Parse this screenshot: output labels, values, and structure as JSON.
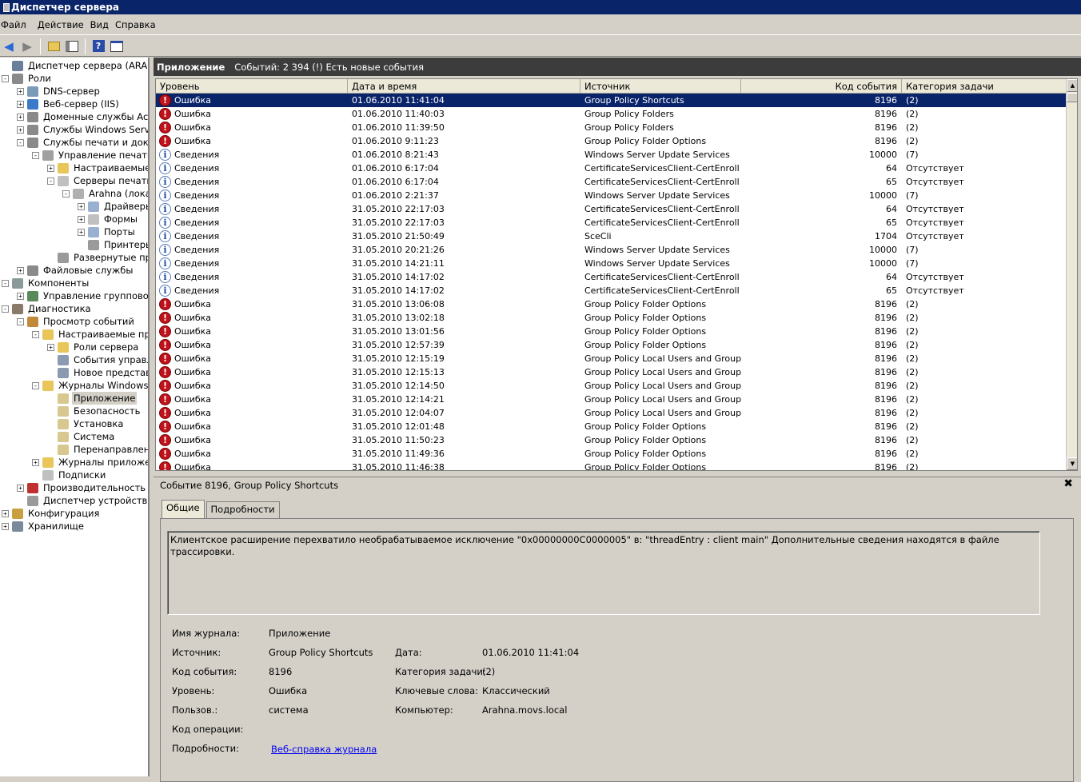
{
  "window": {
    "title": "Диспетчер сервера"
  },
  "menu": [
    "Файл",
    "Действие",
    "Вид",
    "Справка"
  ],
  "toolbar": {
    "buttons": [
      "back-icon",
      "forward-icon",
      "up-folder-icon",
      "show-hide-tree-icon",
      "help-icon",
      "properties-icon"
    ]
  },
  "tree": [
    {
      "label": "Диспетчер сервера (ARAHNA)",
      "exp": "",
      "icon": "server-manager-icon",
      "color": "#6a7f9a"
    },
    {
      "label": "Роли",
      "exp": "-",
      "icon": "roles-icon",
      "color": "#8a8a8a"
    },
    {
      "label": "DNS-сервер",
      "exp": "+",
      "icon": "dns-icon",
      "color": "#7a9ab8"
    },
    {
      "label": "Веб-сервер (IIS)",
      "exp": "+",
      "icon": "iis-icon",
      "color": "#3a7ac8"
    },
    {
      "label": "Доменные службы Active",
      "exp": "+",
      "icon": "ad-icon",
      "color": "#8a8a8a"
    },
    {
      "label": "Службы Windows Server L",
      "exp": "+",
      "icon": "wsus-icon",
      "color": "#8a8a8a"
    },
    {
      "label": "Службы печати и докуме",
      "exp": "-",
      "icon": "print-services-icon",
      "color": "#8a8a8a"
    },
    {
      "label": "Управление печатью",
      "exp": "-",
      "icon": "print-management-icon",
      "color": "#a0a0a0"
    },
    {
      "label": "Настраиваемые фи",
      "exp": "+",
      "icon": "filter-folder-icon",
      "color": "#e8c65a"
    },
    {
      "label": "Серверы печати",
      "exp": "-",
      "icon": "print-servers-icon",
      "color": "#c0c0c0"
    },
    {
      "label": "Arahna (локалі",
      "exp": "-",
      "icon": "server-icon",
      "color": "#b0b0b0"
    },
    {
      "label": "Драйверы",
      "exp": "+",
      "icon": "drivers-icon",
      "color": "#9ab0d0"
    },
    {
      "label": "Формы",
      "exp": "+",
      "icon": "forms-icon",
      "color": "#c0c0c0"
    },
    {
      "label": "Порты",
      "exp": "+",
      "icon": "ports-icon",
      "color": "#9ab0d0"
    },
    {
      "label": "Принтеры",
      "exp": "",
      "icon": "printer-icon",
      "color": "#9a9a9a"
    },
    {
      "label": "Развернутые при",
      "exp": "",
      "icon": "printer-icon",
      "color": "#9a9a9a"
    },
    {
      "label": "Файловые службы",
      "exp": "+",
      "icon": "file-services-icon",
      "color": "#8a8a8a"
    },
    {
      "label": "Компоненты",
      "exp": "-",
      "icon": "features-icon",
      "color": "#8a9a9a"
    },
    {
      "label": "Управление групповой пс",
      "exp": "+",
      "icon": "gpo-icon",
      "color": "#5a8a5a"
    },
    {
      "label": "Диагностика",
      "exp": "-",
      "icon": "diagnostics-icon",
      "color": "#8a7a6a"
    },
    {
      "label": "Просмотр событий",
      "exp": "-",
      "icon": "event-viewer-icon",
      "color": "#c08a3a"
    },
    {
      "label": "Настраиваемые предс",
      "exp": "-",
      "icon": "folder-icon",
      "color": "#e8c65a"
    },
    {
      "label": "Роли сервера",
      "exp": "+",
      "icon": "folder-icon",
      "color": "#e8c65a"
    },
    {
      "label": "События управле",
      "exp": "",
      "icon": "filter-icon",
      "color": "#8a9ab0"
    },
    {
      "label": "Новое представле",
      "exp": "",
      "icon": "filter-icon",
      "color": "#8a9ab0"
    },
    {
      "label": "Журналы Windows",
      "exp": "-",
      "icon": "folder-icon",
      "color": "#e8c65a"
    },
    {
      "label": "Приложение",
      "exp": "",
      "icon": "log-icon",
      "color": "#d8c890",
      "selected": true
    },
    {
      "label": "Безопасность",
      "exp": "",
      "icon": "log-icon",
      "color": "#d8c890"
    },
    {
      "label": "Установка",
      "exp": "",
      "icon": "log-icon",
      "color": "#d8c890"
    },
    {
      "label": "Система",
      "exp": "",
      "icon": "log-icon",
      "color": "#d8c890"
    },
    {
      "label": "Перенаправленны",
      "exp": "",
      "icon": "log-icon",
      "color": "#d8c890"
    },
    {
      "label": "Журналы приложений",
      "exp": "+",
      "icon": "folder-icon",
      "color": "#e8c65a"
    },
    {
      "label": "Подписки",
      "exp": "",
      "icon": "subscriptions-icon",
      "color": "#c0c0c0"
    },
    {
      "label": "Производительность",
      "exp": "+",
      "icon": "performance-icon",
      "color": "#c03030"
    },
    {
      "label": "Диспетчер устройств",
      "exp": "",
      "icon": "device-manager-icon",
      "color": "#9a9a9a"
    },
    {
      "label": "Конфигурация",
      "exp": "+",
      "icon": "configuration-icon",
      "color": "#c8a040"
    },
    {
      "label": "Хранилище",
      "exp": "+",
      "icon": "storage-icon",
      "color": "#7a8a9a"
    }
  ],
  "header": {
    "title": "Приложение",
    "summary": "Событий: 2 394 (!) Есть новые события"
  },
  "columns": [
    "Уровень",
    "Дата и время",
    "Источник",
    "Код события",
    "Категория задачи"
  ],
  "events": [
    {
      "level": "Ошибка",
      "type": "err",
      "date": "01.06.2010 11:41:04",
      "source": "Group Policy Shortcuts",
      "code": "8196",
      "category": "(2)",
      "selected": true
    },
    {
      "level": "Ошибка",
      "type": "err",
      "date": "01.06.2010 11:40:03",
      "source": "Group Policy Folders",
      "code": "8196",
      "category": "(2)"
    },
    {
      "level": "Ошибка",
      "type": "err",
      "date": "01.06.2010 11:39:50",
      "source": "Group Policy Folders",
      "code": "8196",
      "category": "(2)"
    },
    {
      "level": "Ошибка",
      "type": "err",
      "date": "01.06.2010 9:11:23",
      "source": "Group Policy Folder Options",
      "code": "8196",
      "category": "(2)"
    },
    {
      "level": "Сведения",
      "type": "info",
      "date": "01.06.2010 8:21:43",
      "source": "Windows Server Update Services",
      "code": "10000",
      "category": "(7)"
    },
    {
      "level": "Сведения",
      "type": "info",
      "date": "01.06.2010 6:17:04",
      "source": "CertificateServicesClient-CertEnroll",
      "code": "64",
      "category": "Отсутствует"
    },
    {
      "level": "Сведения",
      "type": "info",
      "date": "01.06.2010 6:17:04",
      "source": "CertificateServicesClient-CertEnroll",
      "code": "65",
      "category": "Отсутствует"
    },
    {
      "level": "Сведения",
      "type": "info",
      "date": "01.06.2010 2:21:37",
      "source": "Windows Server Update Services",
      "code": "10000",
      "category": "(7)"
    },
    {
      "level": "Сведения",
      "type": "info",
      "date": "31.05.2010 22:17:03",
      "source": "CertificateServicesClient-CertEnroll",
      "code": "64",
      "category": "Отсутствует"
    },
    {
      "level": "Сведения",
      "type": "info",
      "date": "31.05.2010 22:17:03",
      "source": "CertificateServicesClient-CertEnroll",
      "code": "65",
      "category": "Отсутствует"
    },
    {
      "level": "Сведения",
      "type": "info",
      "date": "31.05.2010 21:50:49",
      "source": "SceCli",
      "code": "1704",
      "category": "Отсутствует"
    },
    {
      "level": "Сведения",
      "type": "info",
      "date": "31.05.2010 20:21:26",
      "source": "Windows Server Update Services",
      "code": "10000",
      "category": "(7)"
    },
    {
      "level": "Сведения",
      "type": "info",
      "date": "31.05.2010 14:21:11",
      "source": "Windows Server Update Services",
      "code": "10000",
      "category": "(7)"
    },
    {
      "level": "Сведения",
      "type": "info",
      "date": "31.05.2010 14:17:02",
      "source": "CertificateServicesClient-CertEnroll",
      "code": "64",
      "category": "Отсутствует"
    },
    {
      "level": "Сведения",
      "type": "info",
      "date": "31.05.2010 14:17:02",
      "source": "CertificateServicesClient-CertEnroll",
      "code": "65",
      "category": "Отсутствует"
    },
    {
      "level": "Ошибка",
      "type": "err",
      "date": "31.05.2010 13:06:08",
      "source": "Group Policy Folder Options",
      "code": "8196",
      "category": "(2)"
    },
    {
      "level": "Ошибка",
      "type": "err",
      "date": "31.05.2010 13:02:18",
      "source": "Group Policy Folder Options",
      "code": "8196",
      "category": "(2)"
    },
    {
      "level": "Ошибка",
      "type": "err",
      "date": "31.05.2010 13:01:56",
      "source": "Group Policy Folder Options",
      "code": "8196",
      "category": "(2)"
    },
    {
      "level": "Ошибка",
      "type": "err",
      "date": "31.05.2010 12:57:39",
      "source": "Group Policy Folder Options",
      "code": "8196",
      "category": "(2)"
    },
    {
      "level": "Ошибка",
      "type": "err",
      "date": "31.05.2010 12:15:19",
      "source": "Group Policy Local Users and Groups",
      "code": "8196",
      "category": "(2)"
    },
    {
      "level": "Ошибка",
      "type": "err",
      "date": "31.05.2010 12:15:13",
      "source": "Group Policy Local Users and Groups",
      "code": "8196",
      "category": "(2)"
    },
    {
      "level": "Ошибка",
      "type": "err",
      "date": "31.05.2010 12:14:50",
      "source": "Group Policy Local Users and Groups",
      "code": "8196",
      "category": "(2)"
    },
    {
      "level": "Ошибка",
      "type": "err",
      "date": "31.05.2010 12:14:21",
      "source": "Group Policy Local Users and Groups",
      "code": "8196",
      "category": "(2)"
    },
    {
      "level": "Ошибка",
      "type": "err",
      "date": "31.05.2010 12:04:07",
      "source": "Group Policy Local Users and Groups",
      "code": "8196",
      "category": "(2)"
    },
    {
      "level": "Ошибка",
      "type": "err",
      "date": "31.05.2010 12:01:48",
      "source": "Group Policy Folder Options",
      "code": "8196",
      "category": "(2)"
    },
    {
      "level": "Ошибка",
      "type": "err",
      "date": "31.05.2010 11:50:23",
      "source": "Group Policy Folder Options",
      "code": "8196",
      "category": "(2)"
    },
    {
      "level": "Ошибка",
      "type": "err",
      "date": "31.05.2010 11:49:36",
      "source": "Group Policy Folder Options",
      "code": "8196",
      "category": "(2)"
    },
    {
      "level": "Ошибка",
      "type": "err",
      "date": "31.05.2010 11:46:38",
      "source": "Group Policy Folder Options",
      "code": "8196",
      "category": "(2)"
    }
  ],
  "detail": {
    "title": "Событие 8196, Group Policy Shortcuts",
    "tabs": [
      "Общие",
      "Подробности"
    ],
    "message": "Клиентское расширение перехватило необрабатываемое исключение \"0x00000000C0000005\" в: \"threadEntry : client main\" Дополнительные сведения находятся в файле трассировки.",
    "labels": {
      "log_name": "Имя журнала:",
      "source": "Источник:",
      "event_id": "Код события:",
      "level": "Уровень:",
      "user": "Пользов.:",
      "opcode": "Код операции:",
      "more_info": "Подробности:",
      "date": "Дата:",
      "task_category": "Категория задачи:",
      "keywords": "Ключевые слова:",
      "computer": "Компьютер:"
    },
    "values": {
      "log_name": "Приложение",
      "source": "Group Policy Shortcuts",
      "event_id": "8196",
      "level": "Ошибка",
      "user": "система",
      "opcode": "",
      "more_info": "Веб-справка журнала",
      "date": "01.06.2010 11:41:04",
      "task_category": "(2)",
      "keywords": "Классический",
      "computer": "Arahna.movs.local"
    }
  }
}
